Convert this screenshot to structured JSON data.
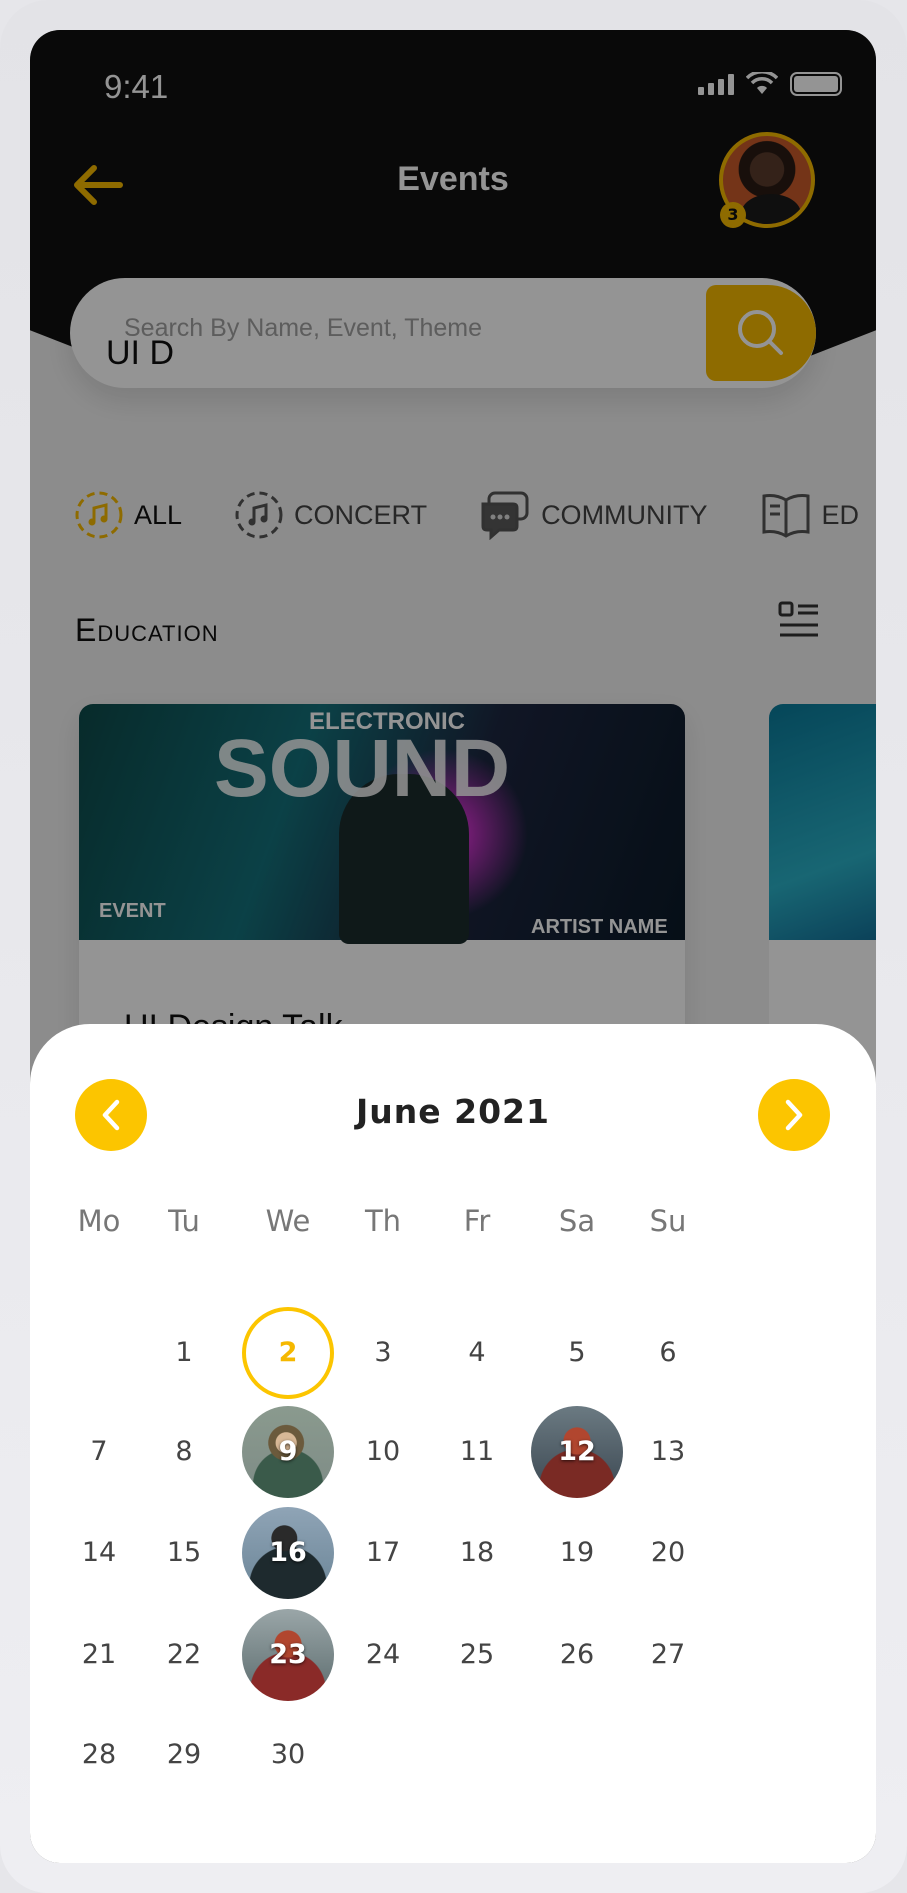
{
  "status": {
    "time": "9:41"
  },
  "header": {
    "title": "Events",
    "avatar_badge": "3"
  },
  "search": {
    "placeholder": "Search By Name, Event, Theme"
  },
  "categories": [
    {
      "label": "ALL",
      "icon": "music-disc-icon",
      "active": true
    },
    {
      "label": "CONCERT",
      "icon": "music-disc-icon",
      "active": false
    },
    {
      "label": "COMMUNITY",
      "icon": "chat-bubbles-icon",
      "active": false
    },
    {
      "label": "ED",
      "icon": "book-icon",
      "active": false
    }
  ],
  "section": {
    "title": "Education"
  },
  "cards": [
    {
      "title": "UI Design Talk",
      "poster": {
        "top": "ELECTRONIC",
        "main": "SOUND",
        "left": "EVENT",
        "right": "ARTIST NAME"
      }
    },
    {
      "title": "UI D"
    }
  ],
  "calendar": {
    "month_label": "June 2021",
    "weekdays": [
      "Mo",
      "Tu",
      "We",
      "Th",
      "Fr",
      "Sa",
      "Su"
    ],
    "selected_day": "2",
    "days_with_events": [
      "9",
      "12",
      "16",
      "23"
    ],
    "weeks": [
      [
        "",
        "1",
        "2",
        "3",
        "4",
        "5",
        "6"
      ],
      [
        "7",
        "8",
        "9",
        "10",
        "11",
        "12",
        "13"
      ],
      [
        "14",
        "15",
        "16",
        "17",
        "18",
        "19",
        "20"
      ],
      [
        "21",
        "22",
        "23",
        "24",
        "25",
        "26",
        "27"
      ],
      [
        "28",
        "29",
        "30",
        "",
        "",
        "",
        ""
      ]
    ]
  },
  "colors": {
    "accent": "#fcc500",
    "dark": "#111111"
  }
}
